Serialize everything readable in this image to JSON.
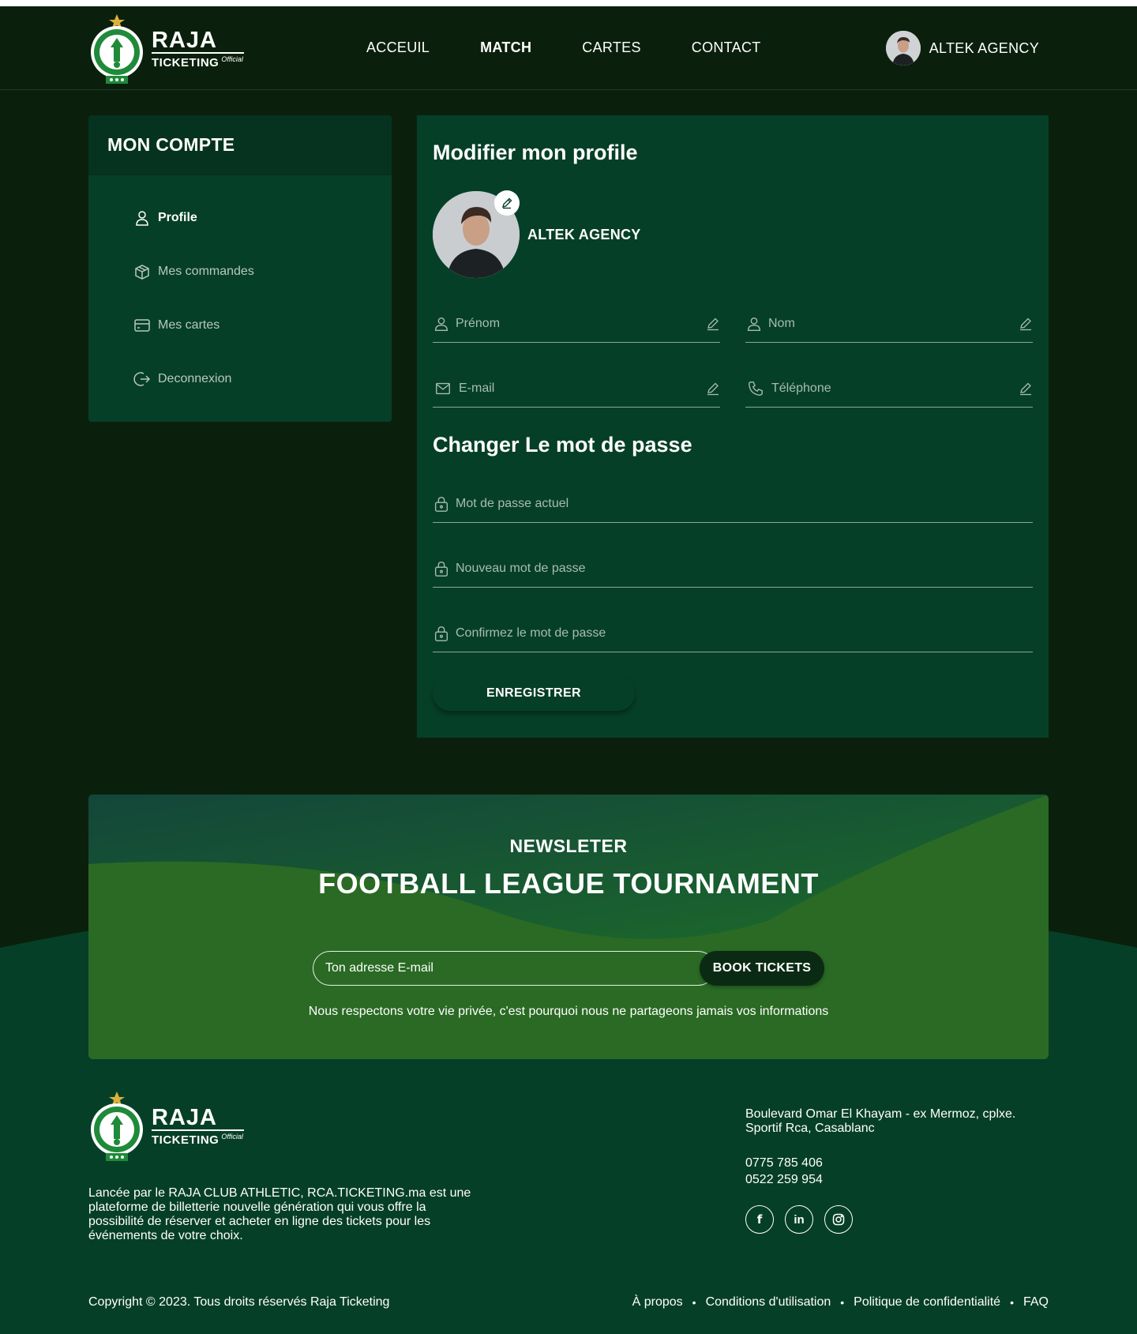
{
  "header": {
    "brand": {
      "name": "RAJA",
      "sub": "TICKETING",
      "tag": "Official"
    },
    "nav": [
      {
        "label": "ACCEUIL",
        "active": false
      },
      {
        "label": "MATCH",
        "active": true
      },
      {
        "label": "CARTES",
        "active": false
      },
      {
        "label": "CONTACT",
        "active": false
      }
    ],
    "user": {
      "name": "ALTEK AGENCY"
    }
  },
  "sidebar": {
    "title": "MON COMPTE",
    "items": [
      {
        "label": "Profile",
        "icon": "user-icon",
        "active": true
      },
      {
        "label": "Mes commandes",
        "icon": "box-icon",
        "active": false
      },
      {
        "label": "Mes cartes",
        "icon": "card-icon",
        "active": false
      },
      {
        "label": "Deconnexion",
        "icon": "logout-icon",
        "active": false
      }
    ]
  },
  "profile": {
    "title": "Modifier mon profile",
    "name": "ALTEK AGENCY",
    "fields": {
      "prenom": "Prénom",
      "nom": "Nom",
      "email": "E-mail",
      "telephone": "Téléphone"
    }
  },
  "password": {
    "title": "Changer Le mot de passe",
    "current": "Mot de passe actuel",
    "new": "Nouveau mot de passe",
    "confirm": "Confirmez le mot de passe",
    "save_label": "ENREGISTRER"
  },
  "newsletter": {
    "eyebrow": "NEWSLETER",
    "title": "FOOTBALL LEAGUE TOURNAMENT",
    "placeholder": "Ton adresse E-mail",
    "button": "BOOK TICKETS",
    "note": "Nous respectons votre vie privée, c'est pourquoi nous ne partageons jamais vos informations"
  },
  "footer": {
    "about": "Lancée par le RAJA CLUB ATHLETIC, RCA.TICKETING.ma est une plateforme de billetterie nouvelle génération qui vous offre la possibilité de réserver et acheter en ligne des tickets pour les événements de votre choix.",
    "address": "Boulevard Omar El Khayam - ex Mermoz, cplxe. Sportif Rca, Casablanc",
    "phone1": "0775 785 406",
    "phone2": "0522 259 954",
    "socials": [
      {
        "icon": "facebook-icon",
        "glyph": "f"
      },
      {
        "icon": "linkedin-icon",
        "glyph": "in"
      },
      {
        "icon": "instagram-icon",
        "glyph": ""
      }
    ],
    "copyright": "Copyright © 2023. Tous droits réservés Raja Ticketing",
    "links": [
      "À propos",
      "Conditions d'utilisation",
      "Politique de confidentialité",
      "FAQ"
    ]
  },
  "colors": {
    "page_bg": "#0b200c",
    "panel_bg": "#063f28",
    "newsletter_bg": "#2a6a24",
    "brand_green": "#1f8a3a"
  }
}
